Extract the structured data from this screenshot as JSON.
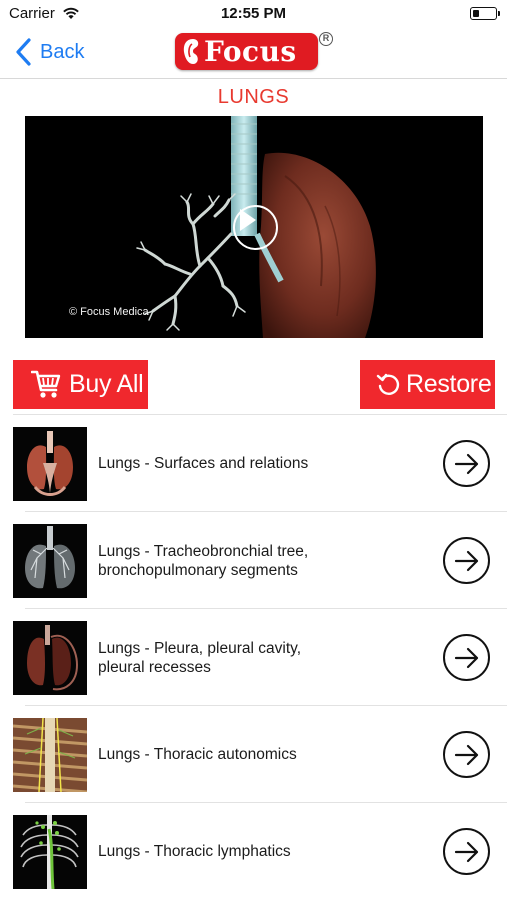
{
  "status_bar": {
    "carrier": "Carrier",
    "time": "12:55 PM"
  },
  "nav": {
    "back_label": "Back",
    "logo_text": "Focus",
    "logo_reg": "R"
  },
  "page": {
    "title": "LUNGS"
  },
  "video": {
    "credit": "© Focus Medica"
  },
  "actions": {
    "buy_all": "Buy All",
    "restore": "Restore"
  },
  "topics": [
    {
      "title_line1": "Lungs - Surfaces and relations",
      "title_line2": ""
    },
    {
      "title_line1": "Lungs - Tracheobronchial tree,",
      "title_line2": "bronchopulmonary segments"
    },
    {
      "title_line1": "Lungs - Pleura, pleural cavity,",
      "title_line2": "pleural recesses"
    },
    {
      "title_line1": "Lungs - Thoracic autonomics",
      "title_line2": ""
    },
    {
      "title_line1": "Lungs - Thoracic lymphatics",
      "title_line2": ""
    }
  ],
  "colors": {
    "accent_red": "#f0282d",
    "title_red": "#e8392f",
    "ios_blue": "#1e7cf2"
  }
}
